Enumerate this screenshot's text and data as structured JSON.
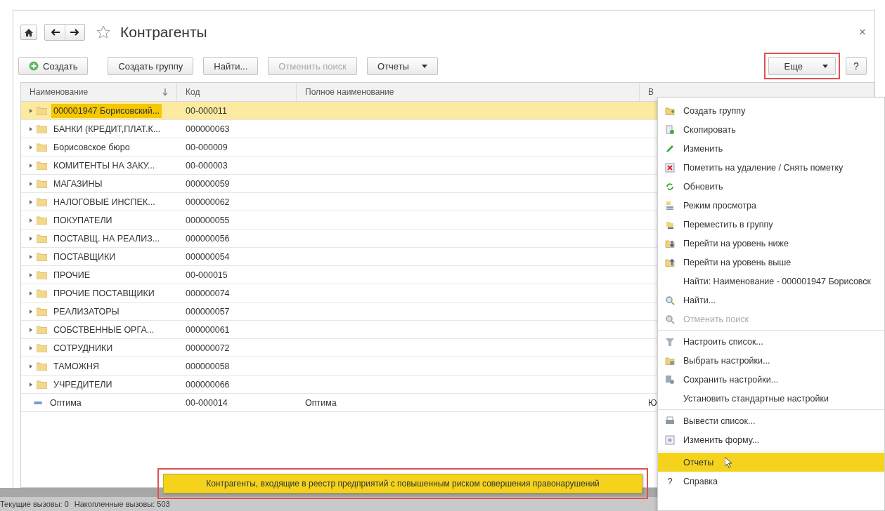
{
  "window": {
    "title": "Контрагенты",
    "favorite": false,
    "close": "×"
  },
  "toolbar": {
    "buttons": [
      {
        "label": "Создать",
        "kind": "create",
        "disabled": false
      },
      {
        "label": "Создать группу",
        "kind": "plain",
        "disabled": false
      },
      {
        "label": "Найти...",
        "kind": "plain",
        "disabled": false
      },
      {
        "label": "Отменить поиск",
        "kind": "plain",
        "disabled": true
      },
      {
        "label": "Отчеты",
        "kind": "dropdown",
        "disabled": false
      }
    ],
    "more": {
      "label": "Еще",
      "annotated": true
    },
    "help": "?"
  },
  "table": {
    "columns": [
      {
        "label": "Наименование",
        "sorted": true
      },
      {
        "label": "Код",
        "sorted": false
      },
      {
        "label": "Полное наименование",
        "sorted": false
      },
      {
        "label": "В",
        "sorted": false
      }
    ],
    "rows": [
      {
        "kind": "group",
        "name": "000001947 Борисовский...",
        "code": "00-000011",
        "selected": true
      },
      {
        "kind": "group",
        "name": "БАНКИ (КРЕДИТ,ПЛАТ.К...",
        "code": "000000063",
        "selected": false
      },
      {
        "kind": "group",
        "name": "Борисовское бюро",
        "code": "00-000009",
        "selected": false
      },
      {
        "kind": "group",
        "name": "КОМИТЕНТЫ НА ЗАКУ...",
        "code": "00-000003",
        "selected": false
      },
      {
        "kind": "group",
        "name": "МАГАЗИНЫ",
        "code": "000000059",
        "selected": false
      },
      {
        "kind": "group",
        "name": "НАЛОГОВЫЕ ИНСПЕК...",
        "code": "000000062",
        "selected": false
      },
      {
        "kind": "group",
        "name": "ПОКУПАТЕЛИ",
        "code": "000000055",
        "selected": false
      },
      {
        "kind": "group",
        "name": "ПОСТАВЩ. НА РЕАЛИЗ...",
        "code": "000000056",
        "selected": false
      },
      {
        "kind": "group",
        "name": "ПОСТАВЩИКИ",
        "code": "000000054",
        "selected": false
      },
      {
        "kind": "group",
        "name": "ПРОЧИЕ",
        "code": "00-000015",
        "selected": false
      },
      {
        "kind": "group",
        "name": "ПРОЧИЕ ПОСТАВЩИКИ",
        "code": "000000074",
        "selected": false
      },
      {
        "kind": "group",
        "name": "РЕАЛИЗАТОРЫ",
        "code": "000000057",
        "selected": false
      },
      {
        "kind": "group",
        "name": "СОБСТВЕННЫЕ ОРГА...",
        "code": "000000061",
        "selected": false
      },
      {
        "kind": "group",
        "name": "СОТРУДНИКИ",
        "code": "000000072",
        "selected": false
      },
      {
        "kind": "group",
        "name": "ТАМОЖНЯ",
        "code": "000000058",
        "selected": false
      },
      {
        "kind": "group",
        "name": "УЧРЕДИТЕЛИ",
        "code": "000000066",
        "selected": false
      },
      {
        "kind": "item",
        "name": "Оптима",
        "code": "00-000014",
        "full_name": "Оптима",
        "column_4": "Ю",
        "selected": false
      }
    ]
  },
  "menu": {
    "items": [
      {
        "kind": "item",
        "label": "Создать группу",
        "disabled": false,
        "selected": false
      },
      {
        "kind": "item",
        "label": "Скопировать",
        "disabled": false,
        "selected": false
      },
      {
        "kind": "item",
        "label": "Изменить",
        "disabled": false,
        "selected": false
      },
      {
        "kind": "item",
        "label": "Пометить на удаление / Снять пометку",
        "disabled": false,
        "selected": false
      },
      {
        "kind": "item",
        "label": "Обновить",
        "disabled": false,
        "selected": false
      },
      {
        "kind": "item",
        "label": "Режим просмотра",
        "disabled": false,
        "selected": false
      },
      {
        "kind": "item",
        "label": "Переместить в группу",
        "disabled": false,
        "selected": false
      },
      {
        "kind": "item",
        "label": "Перейти на уровень ниже",
        "disabled": false,
        "selected": false
      },
      {
        "kind": "item",
        "label": "Перейти на уровень выше",
        "disabled": false,
        "selected": false
      },
      {
        "kind": "item",
        "label": "Найти: Наименование - 000001947 Борисовск",
        "disabled": false,
        "selected": false
      },
      {
        "kind": "item",
        "label": "Найти...",
        "disabled": false,
        "selected": false
      },
      {
        "kind": "item",
        "label": "Отменить поиск",
        "disabled": true,
        "selected": false
      },
      {
        "kind": "separator"
      },
      {
        "kind": "item",
        "label": "Настроить список...",
        "disabled": false,
        "selected": false
      },
      {
        "kind": "item",
        "label": "Выбрать настройки...",
        "disabled": false,
        "selected": false
      },
      {
        "kind": "item",
        "label": "Сохранить настройки...",
        "disabled": false,
        "selected": false
      },
      {
        "kind": "item",
        "label": "Установить стандартные настройки",
        "disabled": false,
        "selected": false
      },
      {
        "kind": "separator"
      },
      {
        "kind": "item",
        "label": "Вывести список...",
        "disabled": false,
        "selected": false
      },
      {
        "kind": "item",
        "label": "Изменить форму...",
        "disabled": false,
        "selected": false
      },
      {
        "kind": "separator"
      },
      {
        "kind": "item",
        "label": "Отчеты",
        "disabled": false,
        "selected": true
      },
      {
        "kind": "help",
        "label": "Справка",
        "glyph": "?",
        "disabled": false,
        "selected": false
      }
    ]
  },
  "submenu": {
    "items": [
      {
        "label": "Контрагенты, входящие в реестр предприятий с повышенным риском совершения правонарушений",
        "selected": true
      }
    ],
    "annotated": true
  },
  "status_bar": {
    "current": "Текущие вызовы: 0",
    "accumulated": "Накопленные вызовы: 503"
  }
}
